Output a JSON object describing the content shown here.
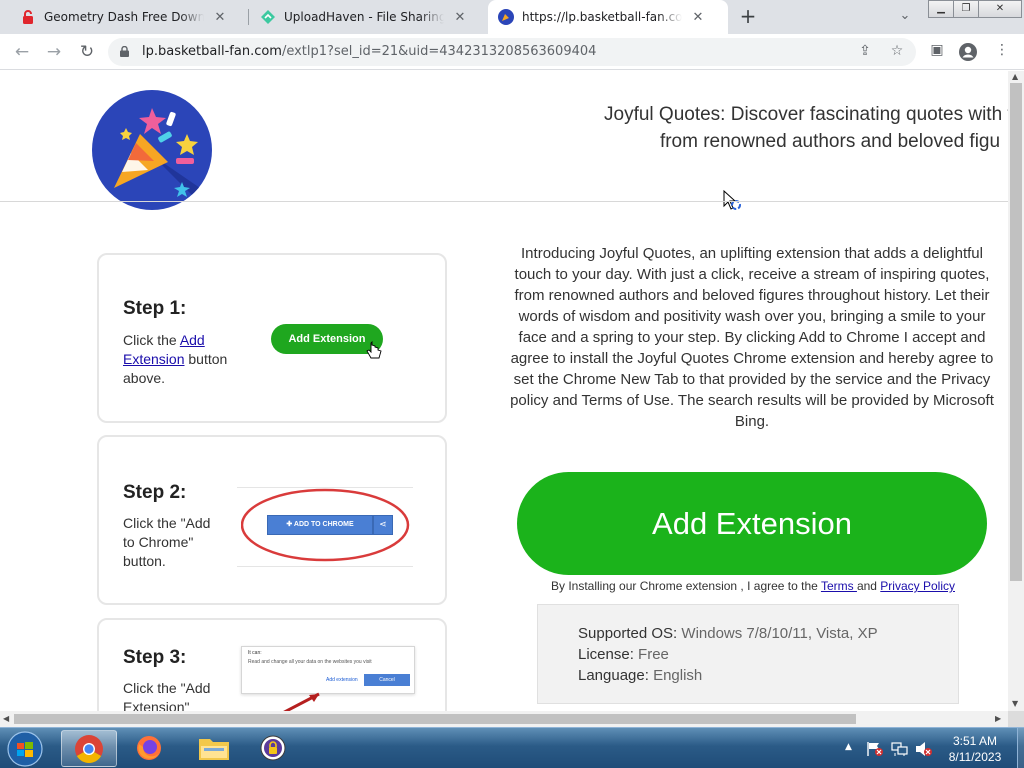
{
  "browser": {
    "tabs": [
      {
        "title": "Geometry Dash Free Download (",
        "active": false
      },
      {
        "title": "UploadHaven - File Sharing Made",
        "active": false
      },
      {
        "title": "https://lp.basketball-fan.com/ext",
        "active": true
      }
    ],
    "url_host": "lp.basketball-fan.com",
    "url_path": "/extlp1?sel_id=21&uid=4342313208563609404"
  },
  "page": {
    "headline_line1": "Joyful Quotes: Discover fascinating quotes with this C",
    "headline_line2": "from renowned authors and beloved figu",
    "steps": [
      {
        "title": "Step 1:",
        "pre": "Click the ",
        "link": "Add Extension",
        "post": " button above.",
        "button": "Add Extension"
      },
      {
        "title": "Step 2:",
        "text": "Click the \"Add to Chrome\" button.",
        "image_button": "ADD TO CHROME"
      },
      {
        "title": "Step 3:",
        "text": "Click the \"Add Extension\"",
        "dialog_title": "It can:",
        "dialog_text": "Read and change all your data on the websites you visit",
        "dialog_add": "Add extension",
        "dialog_cancel": "Cancel"
      }
    ],
    "intro": "Introducing Joyful Quotes, an uplifting extension that adds a delightful touch to your day. With just a click, receive a stream of inspiring quotes, from renowned authors and beloved figures throughout history. Let their words of wisdom and positivity wash over you, bringing a smile to your face and a spring to your step. By clicking Add to Chrome I accept and agree to install the Joyful Quotes Chrome extension and hereby agree to set the Chrome New Tab to that provided by the service and the Privacy policy and Terms of Use. The search results will be provided by Microsoft Bing.",
    "cta": "Add Extension",
    "terms_pre": "By Installing our Chrome extension , I agree to the ",
    "terms_link": "Terms ",
    "terms_mid": "and ",
    "privacy_link": "Privacy Policy",
    "info": [
      {
        "label": "Supported OS: ",
        "value": "Windows 7/8/10/11, Vista, XP"
      },
      {
        "label": "License: ",
        "value": "Free"
      },
      {
        "label": "Language: ",
        "value": "English"
      }
    ]
  },
  "taskbar": {
    "time": "3:51 AM",
    "date": "8/11/2023"
  },
  "colors": {
    "accent_green": "#1bb31b",
    "logo_blue": "#2b45b8",
    "link_blue": "#1a0dab"
  }
}
